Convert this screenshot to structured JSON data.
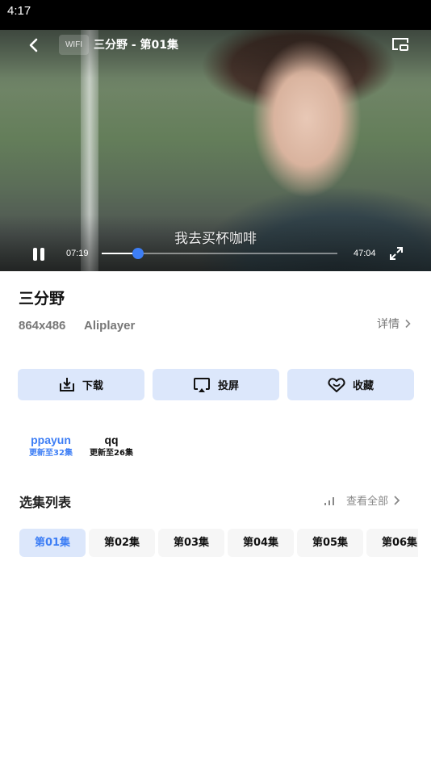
{
  "status_bar": {
    "time": "4:17"
  },
  "player": {
    "network_badge": "WIFI",
    "title": "三分野 - 第01集",
    "subtitle": "我去买杯咖啡",
    "current_time": "07:19",
    "total_time": "47:04",
    "progress_fraction": 0.155,
    "state": "playing",
    "icons": {
      "back": "chevron-left-icon",
      "pip": "picture-in-picture-icon",
      "pause": "pause-icon",
      "fullscreen": "fullscreen-icon"
    },
    "accent_color": "#3d7ef5"
  },
  "info": {
    "title": "三分野",
    "resolution": "864x486",
    "player_name": "Aliplayer",
    "details_label": "详情"
  },
  "actions": [
    {
      "label": "下载",
      "icon": "download-icon"
    },
    {
      "label": "投屏",
      "icon": "cast-screen-icon"
    },
    {
      "label": "收藏",
      "icon": "heart-icon"
    }
  ],
  "sources": [
    {
      "name": "ppayun",
      "update": "更新至32集",
      "active": true
    },
    {
      "name": "qq",
      "update": "更新至26集",
      "active": false
    }
  ],
  "episodes": {
    "title": "选集列表",
    "view_all_label": "查看全部",
    "items": [
      "第01集",
      "第02集",
      "第03集",
      "第04集",
      "第05集",
      "第06集"
    ],
    "selected_index": 0
  },
  "colors": {
    "accent": "#3d7ef5",
    "button_bg": "#dce7fb",
    "episode_bg": "#f6f6f6",
    "muted_text": "#777777"
  }
}
